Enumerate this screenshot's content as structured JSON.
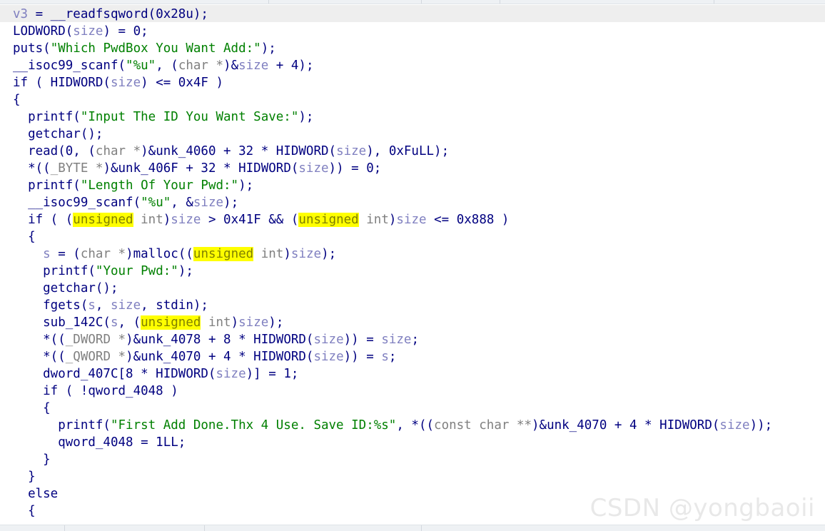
{
  "colors": {
    "keyword": "#000080",
    "variable": "#8080c0",
    "string": "#008000",
    "type": "#808080",
    "highlight_bg": "#ffff00",
    "current_line_bg": "#eeeeee"
  },
  "code": {
    "lines": [
      [
        {
          "t": "v3",
          "c": "var"
        },
        {
          "t": " = __readfsqword(0x28u);"
        }
      ],
      [
        {
          "t": "LODWORD("
        },
        {
          "t": "size",
          "c": "var"
        },
        {
          "t": ") = 0;"
        }
      ],
      [
        {
          "t": "puts("
        },
        {
          "t": "\"Which PwdBox You Want Add:\"",
          "c": "str"
        },
        {
          "t": ");"
        }
      ],
      [
        {
          "t": "__isoc99_scanf("
        },
        {
          "t": "\"%u\"",
          "c": "str"
        },
        {
          "t": ", ("
        },
        {
          "t": "char *",
          "c": "typ"
        },
        {
          "t": ")&"
        },
        {
          "t": "size",
          "c": "var"
        },
        {
          "t": " + 4);"
        }
      ],
      [
        {
          "t": "if ( HIDWORD("
        },
        {
          "t": "size",
          "c": "var"
        },
        {
          "t": ") <= 0x4F )"
        }
      ],
      [
        {
          "t": "{"
        }
      ],
      [
        {
          "t": "  printf("
        },
        {
          "t": "\"Input The ID You Want Save:\"",
          "c": "str"
        },
        {
          "t": ");"
        }
      ],
      [
        {
          "t": "  getchar();"
        }
      ],
      [
        {
          "t": "  read(0, ("
        },
        {
          "t": "char *",
          "c": "typ"
        },
        {
          "t": ")&unk_4060 + 32 * HIDWORD("
        },
        {
          "t": "size",
          "c": "var"
        },
        {
          "t": "), 0xFuLL);"
        }
      ],
      [
        {
          "t": "  *(("
        },
        {
          "t": "_BYTE *",
          "c": "typ"
        },
        {
          "t": ")&unk_406F + 32 * HIDWORD("
        },
        {
          "t": "size",
          "c": "var"
        },
        {
          "t": ")) = 0;"
        }
      ],
      [
        {
          "t": "  printf("
        },
        {
          "t": "\"Length Of Your Pwd:\"",
          "c": "str"
        },
        {
          "t": ");"
        }
      ],
      [
        {
          "t": "  __isoc99_scanf("
        },
        {
          "t": "\"%u\"",
          "c": "str"
        },
        {
          "t": ", &"
        },
        {
          "t": "size",
          "c": "var"
        },
        {
          "t": ");"
        }
      ],
      [
        {
          "t": "  if ( ("
        },
        {
          "t": "unsigned",
          "c": "hl"
        },
        {
          "t": " int",
          "c": "typ"
        },
        {
          "t": ")"
        },
        {
          "t": "size",
          "c": "var"
        },
        {
          "t": " > 0x41F && ("
        },
        {
          "t": "unsigned",
          "c": "hl"
        },
        {
          "t": " int",
          "c": "typ"
        },
        {
          "t": ")"
        },
        {
          "t": "size",
          "c": "var"
        },
        {
          "t": " <= 0x888 )"
        }
      ],
      [
        {
          "t": "  {"
        }
      ],
      [
        {
          "t": "    "
        },
        {
          "t": "s",
          "c": "var"
        },
        {
          "t": " = ("
        },
        {
          "t": "char *",
          "c": "typ"
        },
        {
          "t": ")malloc(("
        },
        {
          "t": "unsigned",
          "c": "hl"
        },
        {
          "t": " int",
          "c": "typ"
        },
        {
          "t": ")"
        },
        {
          "t": "size",
          "c": "var"
        },
        {
          "t": ");"
        }
      ],
      [
        {
          "t": "    printf("
        },
        {
          "t": "\"Your Pwd:\"",
          "c": "str"
        },
        {
          "t": ");"
        }
      ],
      [
        {
          "t": "    getchar();"
        }
      ],
      [
        {
          "t": "    fgets("
        },
        {
          "t": "s",
          "c": "var"
        },
        {
          "t": ", "
        },
        {
          "t": "size",
          "c": "var"
        },
        {
          "t": ", stdin);"
        }
      ],
      [
        {
          "t": "    sub_142C("
        },
        {
          "t": "s",
          "c": "var"
        },
        {
          "t": ", ("
        },
        {
          "t": "unsigned",
          "c": "hl"
        },
        {
          "t": " int",
          "c": "typ"
        },
        {
          "t": ")"
        },
        {
          "t": "size",
          "c": "var"
        },
        {
          "t": ");"
        }
      ],
      [
        {
          "t": "    *(("
        },
        {
          "t": "_DWORD *",
          "c": "typ"
        },
        {
          "t": ")&unk_4078 + 8 * HIDWORD("
        },
        {
          "t": "size",
          "c": "var"
        },
        {
          "t": ")) = "
        },
        {
          "t": "size",
          "c": "var"
        },
        {
          "t": ";"
        }
      ],
      [
        {
          "t": "    *(("
        },
        {
          "t": "_QWORD *",
          "c": "typ"
        },
        {
          "t": ")&unk_4070 + 4 * HIDWORD("
        },
        {
          "t": "size",
          "c": "var"
        },
        {
          "t": ")) = "
        },
        {
          "t": "s",
          "c": "var"
        },
        {
          "t": ";"
        }
      ],
      [
        {
          "t": "    dword_407C[8 * HIDWORD("
        },
        {
          "t": "size",
          "c": "var"
        },
        {
          "t": ")] = 1;"
        }
      ],
      [
        {
          "t": "    if ( !qword_4048 )"
        }
      ],
      [
        {
          "t": "    {"
        }
      ],
      [
        {
          "t": "      printf("
        },
        {
          "t": "\"First Add Done.Thx 4 Use. Save ID:%s\"",
          "c": "str"
        },
        {
          "t": ", *(("
        },
        {
          "t": "const char **",
          "c": "typ"
        },
        {
          "t": ")&unk_4070 + 4 * HIDWORD("
        },
        {
          "t": "size",
          "c": "var"
        },
        {
          "t": "));"
        }
      ],
      [
        {
          "t": "      qword_4048 = 1LL;"
        }
      ],
      [
        {
          "t": "    }"
        }
      ],
      [
        {
          "t": "  }"
        }
      ],
      [
        {
          "t": "  else"
        }
      ],
      [
        {
          "t": "  {"
        }
      ]
    ]
  },
  "watermark": "CSDN @yongbaoii"
}
